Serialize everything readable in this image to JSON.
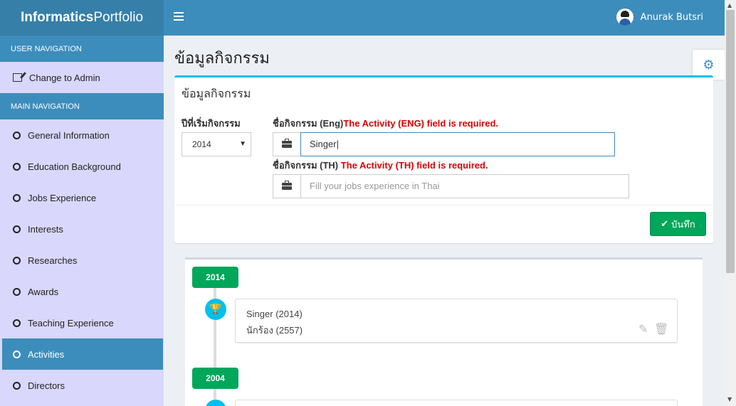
{
  "brand": {
    "bold": "Informatics",
    "light": "Portfolio"
  },
  "navbar": {
    "user_name": "Anurak Butsri"
  },
  "sidebar": {
    "user_nav_header": "USER NAVIGATION",
    "change_admin": "Change to Admin",
    "main_nav_header": "MAIN NAVIGATION",
    "items": [
      {
        "label": "General Information"
      },
      {
        "label": "Education Background"
      },
      {
        "label": "Jobs Experience"
      },
      {
        "label": "Interests"
      },
      {
        "label": "Researches"
      },
      {
        "label": "Awards"
      },
      {
        "label": "Teaching Experience"
      },
      {
        "label": "Activities",
        "active": true
      },
      {
        "label": "Directors"
      }
    ]
  },
  "page": {
    "title": "ข้อมูลกิจกรรม"
  },
  "form": {
    "box_title": "ข้อมูลกิจกรรม",
    "year_label": "ปีที่เริ่มกิจกรรม",
    "year_value": "2014",
    "eng_label": "ชื่อกิจกรรม (Eng)",
    "eng_error": "The Activity (ENG) field is required.",
    "eng_value": "Singer",
    "th_label": "ชื่อกิจกรรม (TH)",
    "th_error": "The Activity (TH) field is required.",
    "th_placeholder": "Fill your jobs experience in Thai",
    "save_label": "บันทึก"
  },
  "timeline": {
    "groups": [
      {
        "year": "2014",
        "items": [
          {
            "eng": "Singer (2014)",
            "th": "นักร้อง (2557)"
          }
        ]
      },
      {
        "year": "2004"
      }
    ]
  },
  "colors": {
    "primary": "#3c8dbc",
    "success": "#00a65a",
    "info": "#00c0ef",
    "error": "#dd0000",
    "sidebar_bg": "#d9d7fb"
  }
}
